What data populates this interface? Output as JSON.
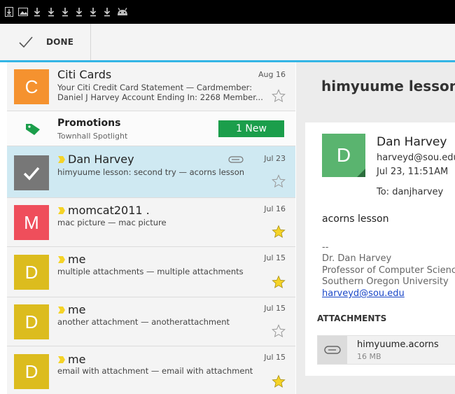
{
  "status_bar": {
    "icons": [
      "download-box-icon",
      "image-icon",
      "download-icon",
      "download-icon",
      "download-icon",
      "download-icon",
      "download-icon",
      "download-icon",
      "android-icon"
    ]
  },
  "action_bar": {
    "done_label": "DONE"
  },
  "conversations": [
    {
      "sender": "Citi Cards",
      "snippet_line1": "Your Citi Credit Card Statement — Cardmember:",
      "snippet_line2": "Daniel J Harvey Account Ending In: 2268 Member...",
      "date": "Aug 16",
      "avatar_letter": "C",
      "avatar_color": "#f5922f",
      "starred": false
    },
    {
      "sender": "Promotions",
      "snippet_line1": "Townhall Spotlight",
      "badge": "1 New",
      "badge_color": "#1b9e4b"
    },
    {
      "sender": "Dan Harvey",
      "snippet_line1": "himyuume lesson: second try — acorns lesson",
      "date": "Jul 23",
      "has_attachment": true,
      "selected": true,
      "starred": false
    },
    {
      "sender": "momcat2011 .",
      "snippet_line1": "mac picture — mac picture",
      "date": "Jul 16",
      "avatar_letter": "M",
      "avatar_color": "#ef4e5b",
      "starred": true
    },
    {
      "sender": "me",
      "snippet_line1": "multiple attachments — multiple attachments",
      "date": "Jul 15",
      "avatar_letter": "D",
      "avatar_color": "#dcbc1e",
      "starred": true
    },
    {
      "sender": "me",
      "snippet_line1": "another attachment — anotherattachment",
      "date": "Jul 15",
      "avatar_letter": "D",
      "avatar_color": "#dcbc1e",
      "starred": false
    },
    {
      "sender": "me",
      "snippet_line1": "email with attachment — email with attachment",
      "date": "Jul 15",
      "avatar_letter": "D",
      "avatar_color": "#dcbc1e",
      "starred": true
    }
  ],
  "message": {
    "subject": "himyuume lesson:",
    "from_name": "Dan Harvey",
    "from_email": "harveyd@sou.edu",
    "date": "Jul 23, 11:51AM",
    "to": "To: danjharvey",
    "avatar_letter": "D",
    "avatar_color": "#5ab46f",
    "body": "acorns lesson",
    "sig_sep": "--",
    "sig_name": "Dr. Dan Harvey",
    "sig_title": "Professor of Computer Science",
    "sig_org": "Southern Oregon University",
    "sig_email": "harveyd@sou.edu",
    "attachments_heading": "ATTACHMENTS",
    "attachment": {
      "name": "himyuume.acorns",
      "size": "16 MB"
    }
  },
  "colors": {
    "accent": "#33b5e5",
    "star_filled": "#f5d327",
    "selected_row": "#cfe9f2",
    "link": "#1a47c8"
  }
}
